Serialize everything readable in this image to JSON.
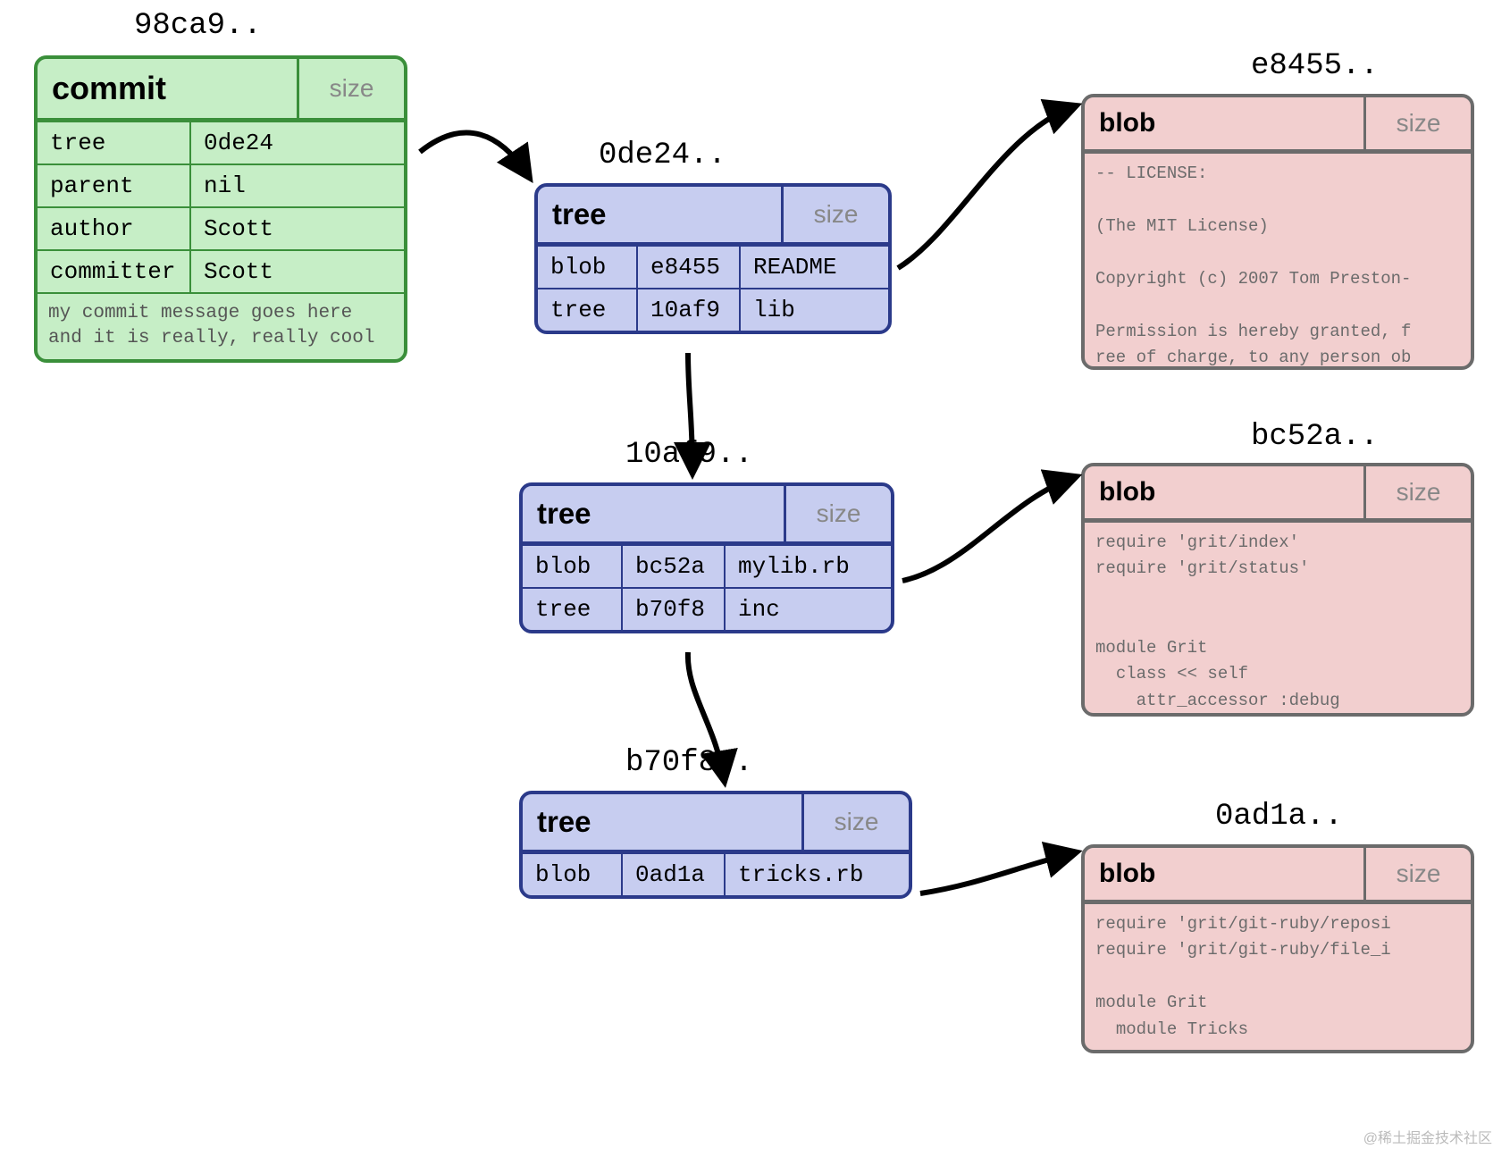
{
  "size_label": "size",
  "commit": {
    "hash": "98ca9..",
    "type": "commit",
    "rows": [
      {
        "k": "tree",
        "v": "0de24"
      },
      {
        "k": "parent",
        "v": "nil"
      },
      {
        "k": "author",
        "v": "Scott"
      },
      {
        "k": "committer",
        "v": "Scott"
      }
    ],
    "message": "my commit message goes here\nand it is really, really cool"
  },
  "trees": [
    {
      "hash": "0de24..",
      "type": "tree",
      "rows": [
        {
          "kind": "blob",
          "sha": "e8455",
          "name": "README"
        },
        {
          "kind": "tree",
          "sha": "10af9",
          "name": "lib"
        }
      ]
    },
    {
      "hash": "10af9..",
      "type": "tree",
      "rows": [
        {
          "kind": "blob",
          "sha": "bc52a",
          "name": "mylib.rb"
        },
        {
          "kind": "tree",
          "sha": "b70f8",
          "name": "inc"
        }
      ]
    },
    {
      "hash": "b70f8..",
      "type": "tree",
      "rows": [
        {
          "kind": "blob",
          "sha": "0ad1a",
          "name": "tricks.rb"
        }
      ]
    }
  ],
  "blobs": [
    {
      "hash": "e8455..",
      "type": "blob",
      "content": "-- LICENSE:\n\n(The MIT License)\n\nCopyright (c) 2007 Tom Preston-\n\nPermission is hereby granted, f\nree of charge, to any person ob"
    },
    {
      "hash": "bc52a..",
      "type": "blob",
      "content": "require 'grit/index'\nrequire 'grit/status'\n\n\nmodule Grit\n  class << self\n    attr_accessor :debug"
    },
    {
      "hash": "0ad1a..",
      "type": "blob",
      "content": "require 'grit/git-ruby/reposi\nrequire 'grit/git-ruby/file_i\n\nmodule Grit\n  module Tricks"
    }
  ],
  "watermark": "@稀土掘金技术社区"
}
